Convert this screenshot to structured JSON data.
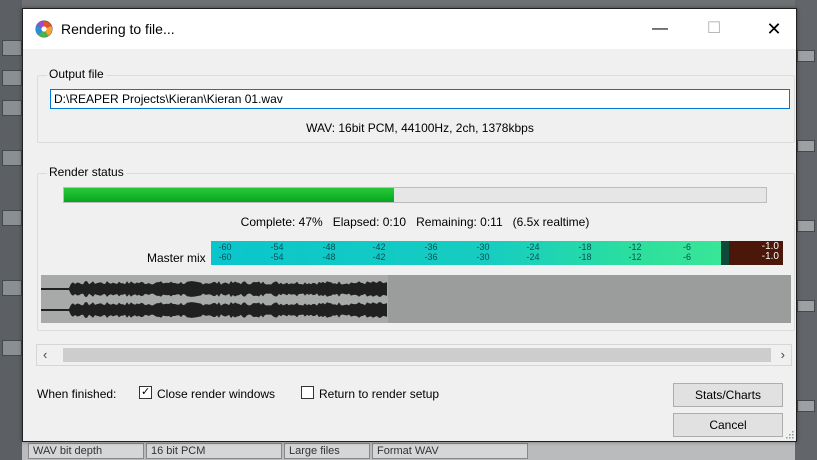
{
  "window": {
    "title": "Rendering to file..."
  },
  "output": {
    "group_label": "Output file",
    "path": "D:\\REAPER Projects\\Kieran\\Kieran 01.wav",
    "format_info": "WAV: 16bit PCM, 44100Hz, 2ch, 1378kbps"
  },
  "render_status": {
    "group_label": "Render status",
    "progress_fraction": 0.47,
    "complete": "Complete: 47%",
    "elapsed": "Elapsed: 0:10",
    "remaining": "Remaining: 0:11",
    "realtime": "(6.5x realtime)"
  },
  "meter": {
    "label": "Master mix",
    "ticks": [
      "-60",
      "-54",
      "-48",
      "-42",
      "-36",
      "-30",
      "-24",
      "-18",
      "-12",
      "-6"
    ],
    "peak_left": "-1.0",
    "peak_right": "-1.0"
  },
  "options": {
    "when_finished_label": "When finished:",
    "close_render_windows": {
      "label": "Close render windows",
      "checked": true
    },
    "return_to_render_setup": {
      "label": "Return to render setup",
      "checked": false
    }
  },
  "buttons": {
    "stats_charts": "Stats/Charts",
    "cancel": "Cancel"
  },
  "background": {
    "bottom_cells": [
      "WAV bit depth",
      "16 bit PCM",
      "Large files",
      "Format WAV"
    ]
  },
  "colors": {
    "progress": "#1bbf2f",
    "meter": "#0cc7c7",
    "accent": "#0078d7"
  }
}
